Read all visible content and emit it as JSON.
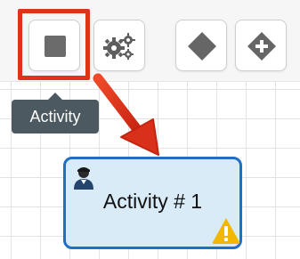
{
  "toolbar": {
    "items": [
      {
        "id": "activity",
        "icon": "square-icon",
        "highlighted": true
      },
      {
        "id": "gateway",
        "icon": "gears-icon"
      },
      {
        "id": "exclusive",
        "icon": "diamond-icon"
      },
      {
        "id": "parallel",
        "icon": "diamond-plus-icon"
      }
    ]
  },
  "tooltip": {
    "text": "Activity"
  },
  "node": {
    "label": "Activity # 1",
    "icons": [
      "user-icon",
      "warning-icon"
    ]
  },
  "colors": {
    "highlight_border": "#e0301e",
    "arrow": "#e0301e",
    "node_fill": "#d8ebf7",
    "node_border": "#1f6fc5",
    "warning": "#f2b705",
    "tooltip_bg": "#4d5960"
  }
}
